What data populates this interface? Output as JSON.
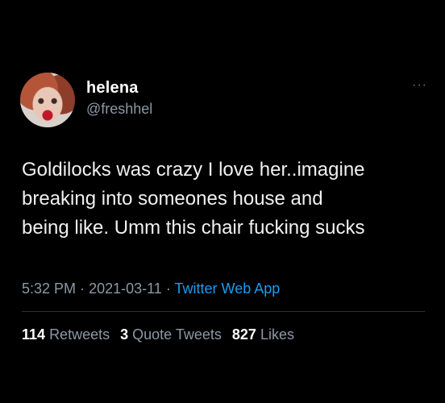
{
  "author": {
    "name": "helena",
    "handle": "@freshhel",
    "avatar_icon": "profile-photo"
  },
  "more_icon": "ellipsis-icon",
  "more_glyph": "···",
  "tweet": {
    "lines": [
      "Goldilocks was crazy I love her..imagine",
      "breaking into someones house and",
      "being like. Umm this chair fucking sucks"
    ]
  },
  "meta": {
    "time": "5:32 PM",
    "separator": "·",
    "date": "2021-03-11",
    "app": "Twitter Web App"
  },
  "stats": {
    "retweets_count": "114",
    "retweets_label": "Retweets",
    "quotes_count": "3",
    "quotes_label": "Quote Tweets",
    "likes_count": "827",
    "likes_label": "Likes"
  },
  "colors": {
    "background": "#000000",
    "link": "#1d9bf0",
    "secondary_text": "#8b98a5"
  }
}
